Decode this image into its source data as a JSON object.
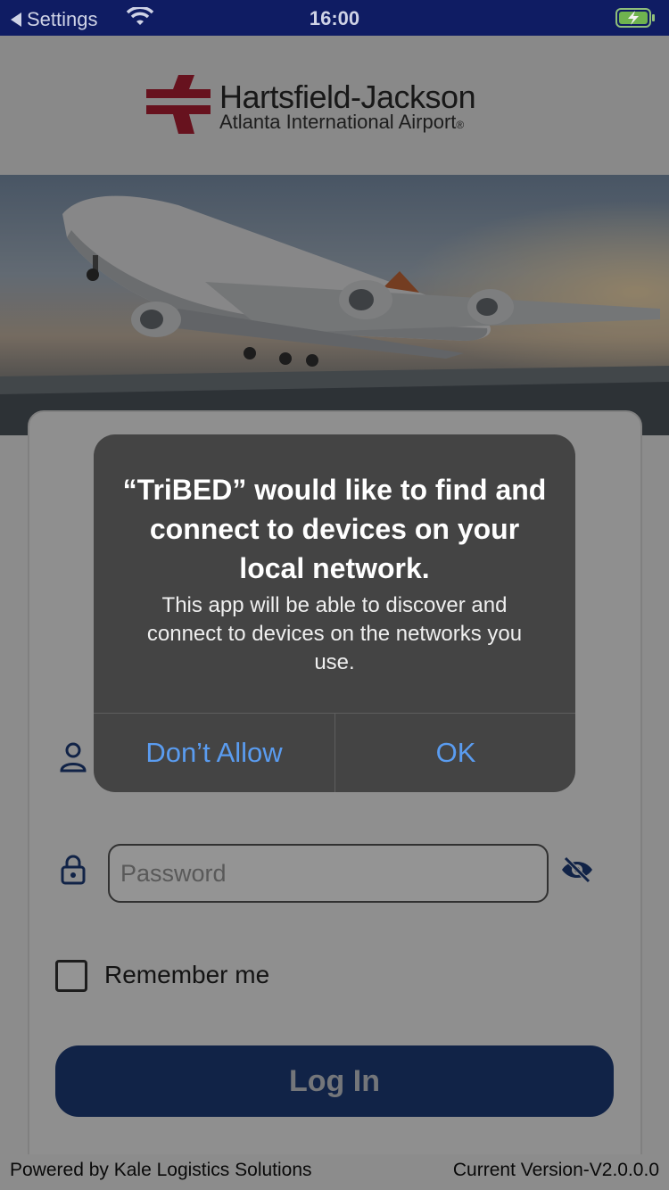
{
  "status_bar": {
    "back_label": "Settings",
    "time": "16:00"
  },
  "header": {
    "logo_name": "Hartsfield-Jackson",
    "logo_sub": "Atlanta International Airport",
    "logo_mark_mark": "®"
  },
  "login": {
    "password_placeholder": "Password",
    "remember_label": "Remember me",
    "login_label": "Log In"
  },
  "footer": {
    "powered_by": "Powered by Kale Logistics Solutions",
    "version": "Current Version-V2.0.0.0"
  },
  "alert": {
    "title": "“TriBED” would like to find and connect to devices on your local network.",
    "message": "This app will be able to discover and connect to devices on the networks you use.",
    "deny_label": "Don’t Allow",
    "ok_label": "OK"
  },
  "colors": {
    "status_bar": "#0f1c63",
    "brand_red": "#b11f35",
    "login_button": "#1e3d7a",
    "alert_button": "#5a9cf0"
  }
}
